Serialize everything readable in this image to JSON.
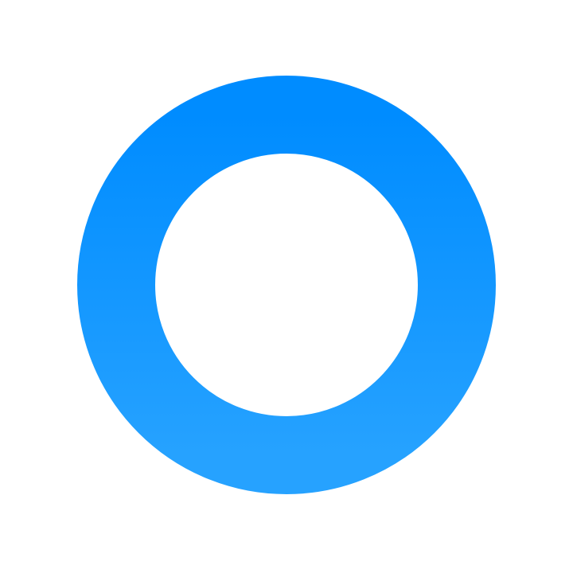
{
  "icon": {
    "name": "ring-icon",
    "gradient_top": "#008cff",
    "gradient_bottom": "#26a2ff",
    "background": "#ffffff"
  }
}
